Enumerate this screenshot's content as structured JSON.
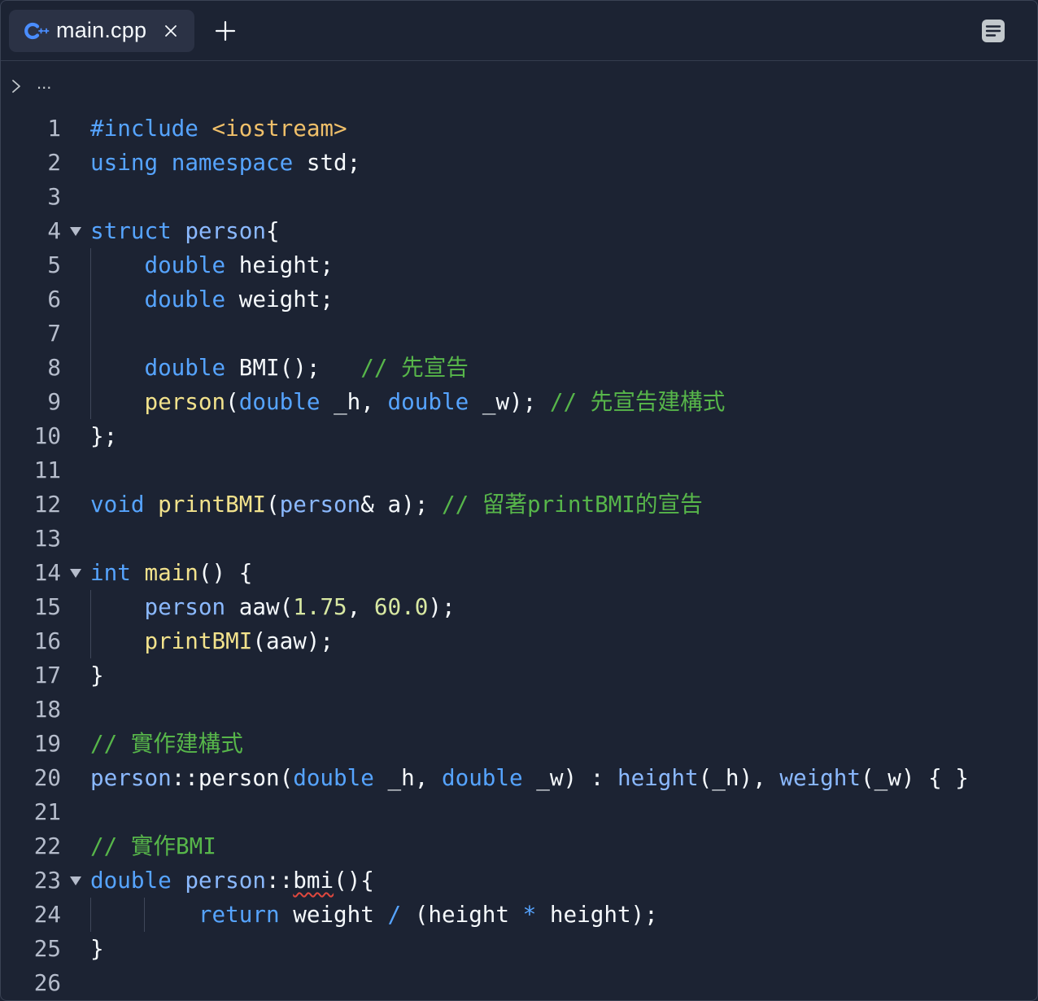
{
  "tab": {
    "label": "main.cpp",
    "icon": "cpp-language-icon"
  },
  "breadcrumb": {
    "ellipsis": "..."
  },
  "colors": {
    "background": "#1c2333",
    "keyword": "#56a4ff",
    "type": "#8bb9ff",
    "string": "#f0c06a",
    "function": "#f2e28c",
    "number": "#d8e8a2",
    "comment": "#57b64a",
    "text": "#f5f9fc",
    "error_underline": "#e0483e"
  },
  "code_lines": [
    {
      "n": "1",
      "tokens": [
        [
          "pp",
          "#include"
        ],
        [
          "pl",
          " "
        ],
        [
          "str",
          "<iostream>"
        ]
      ]
    },
    {
      "n": "2",
      "tokens": [
        [
          "kw",
          "using"
        ],
        [
          "pl",
          " "
        ],
        [
          "kw",
          "namespace"
        ],
        [
          "pl",
          " std;"
        ]
      ]
    },
    {
      "n": "3",
      "tokens": []
    },
    {
      "n": "4",
      "fold": true,
      "tokens": [
        [
          "kw",
          "struct"
        ],
        [
          "pl",
          " "
        ],
        [
          "ty",
          "person"
        ],
        [
          "pl",
          "{"
        ]
      ]
    },
    {
      "n": "5",
      "tokens": [
        [
          "pl",
          "    "
        ],
        [
          "kw",
          "double"
        ],
        [
          "pl",
          " height;"
        ]
      ]
    },
    {
      "n": "6",
      "tokens": [
        [
          "pl",
          "    "
        ],
        [
          "kw",
          "double"
        ],
        [
          "pl",
          " weight;"
        ]
      ]
    },
    {
      "n": "7",
      "tokens": []
    },
    {
      "n": "8",
      "tokens": [
        [
          "pl",
          "    "
        ],
        [
          "kw",
          "double"
        ],
        [
          "pl",
          " BMI();   "
        ],
        [
          "cm",
          "// 先宣告"
        ]
      ]
    },
    {
      "n": "9",
      "tokens": [
        [
          "pl",
          "    "
        ],
        [
          "fn",
          "person"
        ],
        [
          "pl",
          "("
        ],
        [
          "kw",
          "double"
        ],
        [
          "pl",
          " _h, "
        ],
        [
          "kw",
          "double"
        ],
        [
          "pl",
          " _w); "
        ],
        [
          "cm",
          "// 先宣告建構式"
        ]
      ]
    },
    {
      "n": "10",
      "tokens": [
        [
          "pl",
          "};"
        ]
      ]
    },
    {
      "n": "11",
      "tokens": []
    },
    {
      "n": "12",
      "tokens": [
        [
          "kw",
          "void"
        ],
        [
          "pl",
          " "
        ],
        [
          "fn",
          "printBMI"
        ],
        [
          "pl",
          "("
        ],
        [
          "ty",
          "person"
        ],
        [
          "pl",
          "& a); "
        ],
        [
          "cm",
          "// 留著printBMI的宣告"
        ]
      ]
    },
    {
      "n": "13",
      "tokens": []
    },
    {
      "n": "14",
      "fold": true,
      "tokens": [
        [
          "kw",
          "int"
        ],
        [
          "pl",
          " "
        ],
        [
          "fn",
          "main"
        ],
        [
          "pl",
          "() {"
        ]
      ]
    },
    {
      "n": "15",
      "tokens": [
        [
          "pl",
          "    "
        ],
        [
          "ty",
          "person"
        ],
        [
          "pl",
          " aaw("
        ],
        [
          "num",
          "1.75"
        ],
        [
          "pl",
          ", "
        ],
        [
          "num",
          "60.0"
        ],
        [
          "pl",
          ");"
        ]
      ]
    },
    {
      "n": "16",
      "tokens": [
        [
          "pl",
          "    "
        ],
        [
          "fn",
          "printBMI"
        ],
        [
          "pl",
          "(aaw);"
        ]
      ]
    },
    {
      "n": "17",
      "tokens": [
        [
          "pl",
          "}"
        ]
      ]
    },
    {
      "n": "18",
      "tokens": []
    },
    {
      "n": "19",
      "tokens": [
        [
          "cm",
          "// 實作建構式"
        ]
      ]
    },
    {
      "n": "20",
      "tokens": [
        [
          "ty",
          "person"
        ],
        [
          "pl",
          "::person("
        ],
        [
          "kw",
          "double"
        ],
        [
          "pl",
          " _h, "
        ],
        [
          "kw",
          "double"
        ],
        [
          "pl",
          " _w) : "
        ],
        [
          "ty",
          "height"
        ],
        [
          "pl",
          "(_h), "
        ],
        [
          "ty",
          "weight"
        ],
        [
          "pl",
          "(_w) { }"
        ]
      ]
    },
    {
      "n": "21",
      "tokens": []
    },
    {
      "n": "22",
      "tokens": [
        [
          "cm",
          "// 實作BMI"
        ]
      ]
    },
    {
      "n": "23",
      "fold": true,
      "tokens": [
        [
          "kw",
          "double"
        ],
        [
          "pl",
          " "
        ],
        [
          "ty",
          "person"
        ],
        [
          "pl",
          "::"
        ],
        [
          "squig",
          "bmi"
        ],
        [
          "pl",
          "(){"
        ]
      ]
    },
    {
      "n": "24",
      "tokens": [
        [
          "pl",
          "        "
        ],
        [
          "kw",
          "return"
        ],
        [
          "pl",
          " weight "
        ],
        [
          "kw",
          "/"
        ],
        [
          "pl",
          " (height "
        ],
        [
          "kw",
          "*"
        ],
        [
          "pl",
          " height);"
        ]
      ]
    },
    {
      "n": "25",
      "tokens": [
        [
          "pl",
          "}"
        ]
      ]
    },
    {
      "n": "26",
      "tokens": []
    }
  ]
}
